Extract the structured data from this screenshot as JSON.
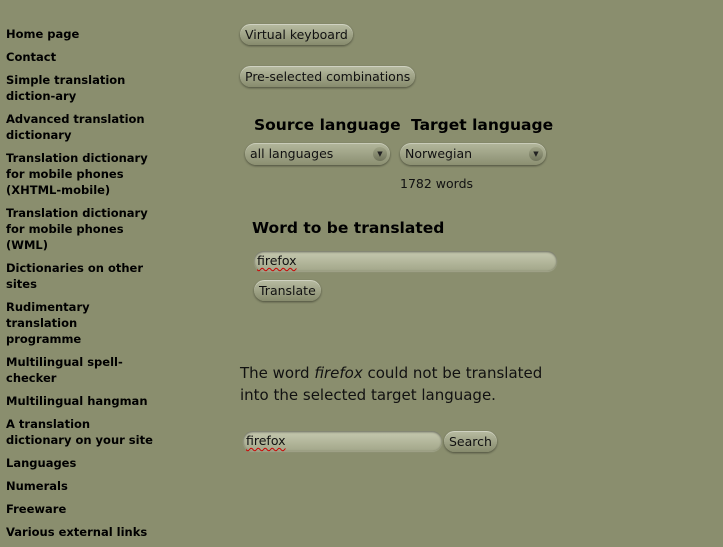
{
  "nav": {
    "items": [
      {
        "label": "Home page"
      },
      {
        "label": "Contact"
      },
      {
        "label": "Simple translation diction-ary"
      },
      {
        "label": "Advanced translation dictionary"
      },
      {
        "label": "Translation dictionary for mobile phones (XHTML-mobile)"
      },
      {
        "label": "Translation dictionary for mobile phones (WML)"
      },
      {
        "label": "Dictionaries on other sites"
      },
      {
        "label": "Rudimentary translation programme"
      },
      {
        "label": "Multilingual spell-checker"
      },
      {
        "label": "Multilingual hangman"
      },
      {
        "label": "A translation dictionary on your site"
      },
      {
        "label": "Languages"
      },
      {
        "label": "Numerals"
      },
      {
        "label": "Freeware"
      },
      {
        "label": "Various external links"
      }
    ]
  },
  "toolbar": {
    "virtual_keyboard_label": "Virtual keyboard",
    "preselected_label": "Pre-selected combinations"
  },
  "languages": {
    "source_heading": "Source language",
    "target_heading": "Target language",
    "source_value": "all languages",
    "target_value": "Norwegian",
    "word_count": "1782 words"
  },
  "translate": {
    "heading": "Word to be translated",
    "input_value": "firefox",
    "button_label": "Translate"
  },
  "result": {
    "prefix": "The word ",
    "word": "firefox",
    "suffix": " could not be translated into the selected target language."
  },
  "search": {
    "input_value": "firefox",
    "button_label": "Search"
  },
  "colors": {
    "background": "#8a8e6e",
    "spellcheck_underline": "#cc0000"
  },
  "icons": {
    "select_arrow": "chevron-down-icon"
  }
}
